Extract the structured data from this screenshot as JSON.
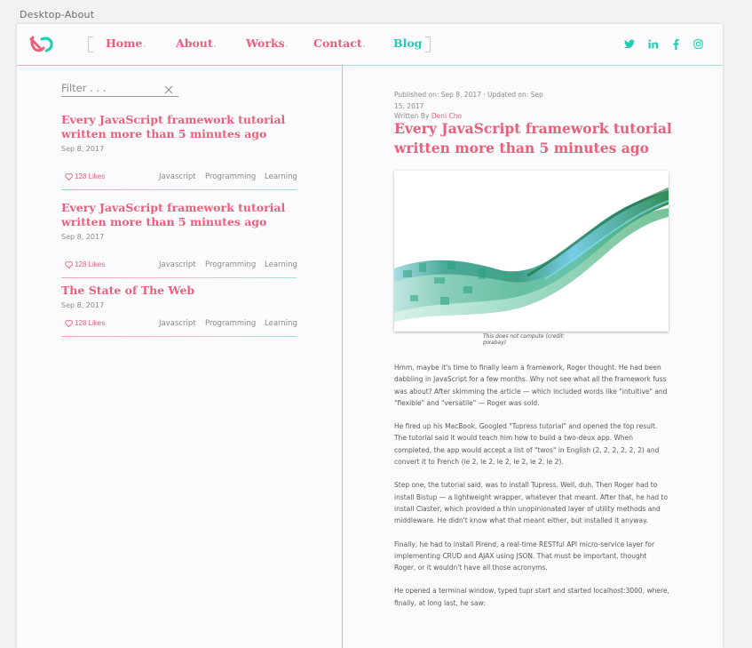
{
  "artboard": {
    "label": "Desktop-About"
  },
  "colors": {
    "accent_pink": "#ea5f7a",
    "accent_teal": "#27c8b5",
    "rule_pink": "#f4a9b7",
    "rule_teal": "#9fe0d8"
  },
  "nav": {
    "items": [
      {
        "label": "Home",
        "dot": "."
      },
      {
        "label": "About",
        "dot": "."
      },
      {
        "label": "Works",
        "dot": "."
      },
      {
        "label": "Contact",
        "dot": "."
      },
      {
        "label": "Blog"
      }
    ],
    "active": "Blog"
  },
  "social": [
    "twitter-icon",
    "linkedin-icon",
    "facebook-icon",
    "instagram-icon"
  ],
  "filter": {
    "placeholder": "Filter . . ."
  },
  "posts": [
    {
      "title": "Every JavaScript framework tutorial written more than 5 minutes ago",
      "date": "Sep 8, 2017",
      "likes": "128 Likes",
      "tags": [
        "Javascript",
        "Programming",
        "Learning"
      ]
    },
    {
      "title": "Every JavaScript framework tutorial written more than 5 minutes ago",
      "date": "Sep 8, 2017",
      "likes": "128 Likes",
      "tags": [
        "Javascript",
        "Programming",
        "Learning"
      ]
    },
    {
      "title": "The State of The Web",
      "date": "Sep 8, 2017",
      "likes": "128 Likes",
      "tags": [
        "Javascript",
        "Programming",
        "Learning"
      ]
    }
  ],
  "article": {
    "published": "Published on: Sep 8, 2017 · Updated on: Sep 15, 2017",
    "written_by": "Written By",
    "author": "Deni Cho",
    "title": "Every JavaScript framework tutorial written more than 5 minutes ago",
    "caption": "This does not compute (credit: pixabay)",
    "paragraphs": [
      "Hmm, maybe it's time to finally learn a framework, Roger thought. He had been dabbling in JavaScript for a few months. Why not see what all the framework fuss was about? After skimming the article — which included words like \"intuitive\" and \"flexible\" and \"versatile\" — Roger was sold.",
      "He fired up his MacBook, Googled \"Tupress tutorial\" and opened the top result. The tutorial said it would teach him how to build a two-deux app. When completed, the app would accept a list of \"twos\" in English (2, 2, 2, 2, 2, 2) and convert it to French (le 2, le 2, le 2, le 2, le 2, le 2).",
      "Step one, the tutorial said, was to install Tupress. Well, duh. Then Roger had to install Bistup — a lightweight wrapper, whatever that meant. After that, he had to install Claster, which provided a thin unopinionated layer of utility methods and middleware. He didn't know what that meant either, but installed it anyway.",
      "Finally, he had to install Pirend, a real-time RESTful API micro-service layer for implementing CRUD and AJAX using JSON. That must be important, thought Roger, or it wouldn't have all those acronyms.",
      "He opened a terminal window, typed tupr start and started localhost:3000, where, finally, at long last, he saw:"
    ]
  }
}
